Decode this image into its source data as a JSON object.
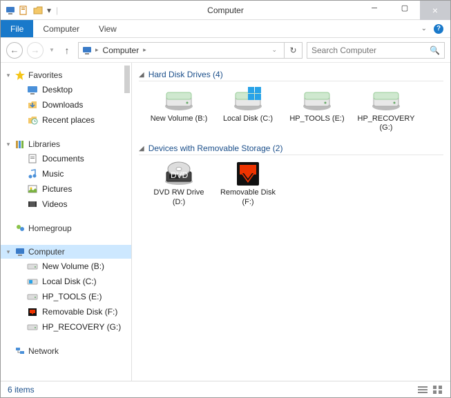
{
  "window": {
    "title": "Computer"
  },
  "ribbon": {
    "file": "File",
    "tabs": [
      "Computer",
      "View"
    ]
  },
  "nav": {
    "breadcrumb": "Computer",
    "search_placeholder": "Search Computer"
  },
  "sidebar": {
    "favorites": {
      "label": "Favorites",
      "items": [
        "Desktop",
        "Downloads",
        "Recent places"
      ]
    },
    "libraries": {
      "label": "Libraries",
      "items": [
        "Documents",
        "Music",
        "Pictures",
        "Videos"
      ]
    },
    "homegroup": {
      "label": "Homegroup"
    },
    "computer": {
      "label": "Computer",
      "items": [
        "New Volume (B:)",
        "Local Disk (C:)",
        "HP_TOOLS (E:)",
        "Removable Disk (F:)",
        "HP_RECOVERY (G:)"
      ]
    },
    "network": {
      "label": "Network"
    }
  },
  "content": {
    "hdd": {
      "title": "Hard Disk Drives (4)",
      "drives": [
        {
          "label": "New Volume (B:)"
        },
        {
          "label": "Local Disk (C:)"
        },
        {
          "label": "HP_TOOLS (E:)"
        },
        {
          "label": "HP_RECOVERY (G:)"
        }
      ]
    },
    "removable": {
      "title": "Devices with Removable Storage (2)",
      "drives": [
        {
          "label": "DVD RW Drive (D:)"
        },
        {
          "label": "Removable Disk (F:)"
        }
      ]
    }
  },
  "status": {
    "text": "6 items"
  }
}
